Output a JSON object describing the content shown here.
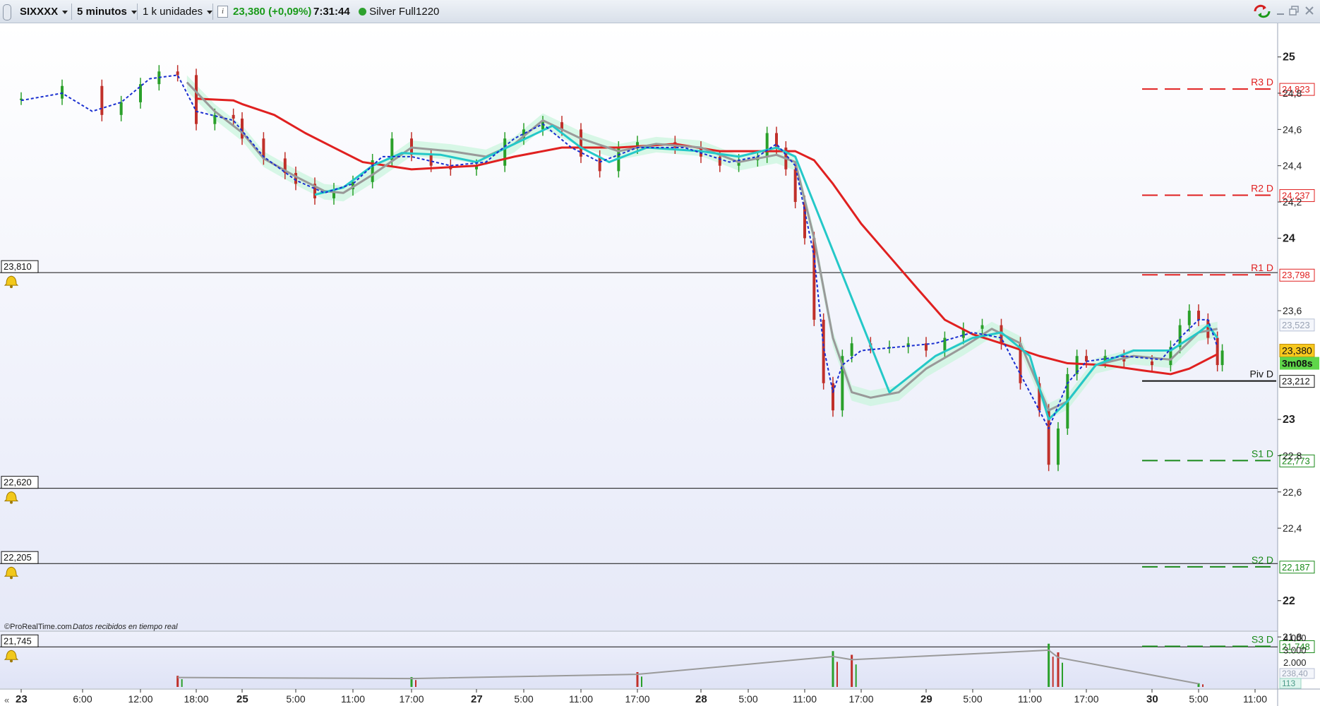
{
  "toolbar": {
    "instrument": "SIXXXX",
    "timeframe": "5 minutos",
    "units": "1 k unidades",
    "info_icon": "info-icon",
    "last_price": "23,380",
    "change_pct": "(+0,09%)",
    "time": "7:31:44",
    "feed_status_icon": "green-status-dot",
    "feed_label": "Silver Full1220",
    "window_controls": [
      "sync-icon",
      "minimize-icon",
      "restore-icon",
      "close-icon"
    ],
    "colors": {
      "price": "#1a9a1a",
      "status_dot": "#2ea12e"
    }
  },
  "chart_data": {
    "type": "line",
    "title": "",
    "subtitle": "",
    "xlabel": "",
    "ylabel": "",
    "ylim": [
      21.75,
      25.1
    ],
    "grid": false,
    "price_axis_ticks": [
      "25",
      "24,8",
      "24,6",
      "24,4",
      "24,2",
      "24",
      "23,6",
      "23",
      "22,8",
      "22,6",
      "22,4",
      "22",
      "21,8"
    ],
    "time_axis_ticks": [
      "23",
      "6:00",
      "12:00",
      "18:00",
      "25",
      "5:00",
      "11:00",
      "17:00",
      "27",
      "5:00",
      "11:00",
      "17:00",
      "28",
      "5:00",
      "11:00",
      "17:00",
      "29",
      "5:00",
      "11:00",
      "17:00",
      "30",
      "5:00",
      "11:00"
    ],
    "bold_time_ticks": [
      "23",
      "25",
      "27",
      "28",
      "29",
      "30"
    ],
    "series": [
      {
        "name": "",
        "style": "candles",
        "color_up": "#2aa02a",
        "color_down": "#c0302a",
        "points": [
          [
            "23 0:00",
            24.77
          ],
          [
            "23 4:00",
            24.84
          ],
          [
            "23 8:00",
            24.68
          ],
          [
            "23 10:00",
            24.75
          ],
          [
            "23 12:00",
            24.85
          ],
          [
            "23 14:00",
            24.92
          ],
          [
            "23 16:00",
            24.9
          ],
          [
            "23 18:00",
            24.63
          ],
          [
            "23 20:00",
            24.68
          ],
          [
            "23 22:00",
            24.66
          ],
          [
            "25 0:00",
            24.55
          ],
          [
            "25 2:00",
            24.44
          ],
          [
            "25 4:00",
            24.36
          ],
          [
            "25 5:00",
            24.3
          ],
          [
            "25 7:00",
            24.22
          ],
          [
            "25 9:00",
            24.27
          ],
          [
            "25 11:00",
            24.31
          ],
          [
            "25 13:00",
            24.43
          ],
          [
            "25 15:00",
            24.55
          ],
          [
            "25 17:00",
            24.46
          ],
          [
            "25 19:00",
            24.4
          ],
          [
            "25 21:00",
            24.38
          ],
          [
            "27 0:00",
            24.4
          ],
          [
            "27 3:00",
            24.55
          ],
          [
            "27 5:00",
            24.6
          ],
          [
            "27 7:00",
            24.64
          ],
          [
            "27 9:00",
            24.6
          ],
          [
            "27 11:00",
            24.45
          ],
          [
            "27 13:00",
            24.37
          ],
          [
            "27 15:00",
            24.5
          ],
          [
            "27 17:00",
            24.53
          ],
          [
            "27 21:00",
            24.5
          ],
          [
            "28 0:00",
            24.45
          ],
          [
            "28 2:00",
            24.4
          ],
          [
            "28 4:00",
            24.43
          ],
          [
            "28 6:00",
            24.45
          ],
          [
            "28 7:00",
            24.58
          ],
          [
            "28 8:00",
            24.5
          ],
          [
            "28 9:00",
            24.38
          ],
          [
            "28 10:00",
            24.2
          ],
          [
            "28 11:00",
            24.0
          ],
          [
            "28 12:00",
            23.55
          ],
          [
            "28 13:00",
            23.2
          ],
          [
            "28 14:00",
            23.05
          ],
          [
            "28 15:00",
            23.35
          ],
          [
            "28 16:00",
            23.42
          ],
          [
            "28 18:00",
            23.4
          ],
          [
            "28 20:00",
            23.4
          ],
          [
            "28 22:00",
            23.42
          ],
          [
            "29 0:00",
            23.38
          ],
          [
            "29 2:00",
            23.45
          ],
          [
            "29 4:00",
            23.5
          ],
          [
            "29 6:00",
            23.52
          ],
          [
            "29 8:00",
            23.42
          ],
          [
            "29 10:00",
            23.2
          ],
          [
            "29 12:00",
            23.05
          ],
          [
            "29 13:00",
            22.75
          ],
          [
            "29 14:00",
            22.95
          ],
          [
            "29 15:00",
            23.25
          ],
          [
            "29 16:00",
            23.35
          ],
          [
            "29 17:00",
            23.32
          ],
          [
            "29 19:00",
            23.35
          ],
          [
            "29 21:00",
            23.32
          ],
          [
            "30 0:00",
            23.3
          ],
          [
            "30 2:00",
            23.4
          ],
          [
            "30 3:00",
            23.52
          ],
          [
            "30 4:00",
            23.6
          ],
          [
            "30 5:00",
            23.55
          ],
          [
            "30 6:00",
            23.45
          ],
          [
            "30 7:00",
            23.3
          ],
          [
            "30 7:31",
            23.38
          ]
        ]
      },
      {
        "name": "",
        "style": "line",
        "color": "#e02020",
        "points": [
          [
            "23 18:00",
            24.77
          ],
          [
            "23 22:00",
            24.76
          ],
          [
            "25 0:00",
            24.74
          ],
          [
            "25 3:00",
            24.68
          ],
          [
            "25 6:00",
            24.58
          ],
          [
            "25 9:00",
            24.5
          ],
          [
            "25 12:00",
            24.42
          ],
          [
            "25 17:00",
            24.38
          ],
          [
            "27 0:00",
            24.4
          ],
          [
            "27 4:00",
            24.45
          ],
          [
            "27 9:00",
            24.5
          ],
          [
            "27 15:00",
            24.5
          ],
          [
            "27 21:00",
            24.52
          ],
          [
            "28 2:00",
            24.48
          ],
          [
            "28 6:00",
            24.48
          ],
          [
            "28 10:00",
            24.48
          ],
          [
            "28 12:00",
            24.43
          ],
          [
            "28 14:00",
            24.3
          ],
          [
            "28 17:00",
            24.08
          ],
          [
            "28 20:00",
            23.9
          ],
          [
            "28 23:00",
            23.72
          ],
          [
            "29 2:00",
            23.55
          ],
          [
            "29 5:00",
            23.47
          ],
          [
            "29 8:00",
            23.42
          ],
          [
            "29 12:00",
            23.35
          ],
          [
            "29 15:00",
            23.31
          ],
          [
            "29 19:00",
            23.3
          ],
          [
            "29 23:00",
            23.27
          ],
          [
            "30 2:00",
            23.25
          ],
          [
            "30 4:00",
            23.28
          ],
          [
            "30 7:00",
            23.36
          ]
        ]
      },
      {
        "name": "",
        "style": "line",
        "color": "#999999",
        "points": [
          [
            "23 17:00",
            24.86
          ],
          [
            "23 20:00",
            24.7
          ],
          [
            "23 23:00",
            24.58
          ],
          [
            "25 2:00",
            24.44
          ],
          [
            "25 5:00",
            24.34
          ],
          [
            "25 8:00",
            24.26
          ],
          [
            "25 10:00",
            24.25
          ],
          [
            "25 13:00",
            24.35
          ],
          [
            "25 17:00",
            24.5
          ],
          [
            "25 21:00",
            24.48
          ],
          [
            "27 1:00",
            24.45
          ],
          [
            "27 4:00",
            24.52
          ],
          [
            "27 7:00",
            24.65
          ],
          [
            "27 11:00",
            24.55
          ],
          [
            "27 15:00",
            24.48
          ],
          [
            "27 19:00",
            24.52
          ],
          [
            "28 0:00",
            24.5
          ],
          [
            "28 4:00",
            24.42
          ],
          [
            "28 8:00",
            24.46
          ],
          [
            "28 10:00",
            24.42
          ],
          [
            "28 12:00",
            24.0
          ],
          [
            "28 14:00",
            23.45
          ],
          [
            "28 16:00",
            23.15
          ],
          [
            "28 18:00",
            23.12
          ],
          [
            "28 21:00",
            23.15
          ],
          [
            "29 0:00",
            23.28
          ],
          [
            "29 4:00",
            23.4
          ],
          [
            "29 7:00",
            23.5
          ],
          [
            "29 10:00",
            23.42
          ],
          [
            "29 13:00",
            23.05
          ],
          [
            "29 15:00",
            23.1
          ],
          [
            "29 18:00",
            23.3
          ],
          [
            "29 22:00",
            23.35
          ],
          [
            "30 2:00",
            23.33
          ],
          [
            "30 5:00",
            23.48
          ],
          [
            "30 7:00",
            23.5
          ]
        ]
      },
      {
        "name": "",
        "style": "line",
        "color": "#24c8c8",
        "points": [
          [
            "25 7:00",
            24.24
          ],
          [
            "25 10:00",
            24.28
          ],
          [
            "25 13:00",
            24.4
          ],
          [
            "25 16:00",
            24.47
          ],
          [
            "25 20:00",
            24.46
          ],
          [
            "27 0:00",
            24.42
          ],
          [
            "27 4:00",
            24.52
          ],
          [
            "27 8:00",
            24.62
          ],
          [
            "27 11:00",
            24.5
          ],
          [
            "27 14:00",
            24.42
          ],
          [
            "27 18:00",
            24.5
          ],
          [
            "28 0:00",
            24.48
          ],
          [
            "28 4:00",
            24.45
          ],
          [
            "28 8:00",
            24.5
          ],
          [
            "28 10:00",
            24.45
          ],
          [
            "28 20:00",
            23.15
          ],
          [
            "29 1:00",
            23.35
          ],
          [
            "29 5:00",
            23.45
          ],
          [
            "29 8:00",
            23.48
          ],
          [
            "29 11:00",
            23.35
          ],
          [
            "29 13:00",
            23.0
          ],
          [
            "29 15:00",
            23.1
          ],
          [
            "29 18:00",
            23.3
          ],
          [
            "29 22:00",
            23.38
          ],
          [
            "30 2:00",
            23.38
          ],
          [
            "30 5:00",
            23.48
          ],
          [
            "30 6:00",
            23.52
          ],
          [
            "30 7:00",
            23.45
          ]
        ]
      },
      {
        "name": "",
        "style": "line",
        "dash": true,
        "color": "#1a2fd0",
        "points": [
          [
            "23 0:00",
            24.76
          ],
          [
            "23 4:00",
            24.8
          ],
          [
            "23 7:00",
            24.7
          ],
          [
            "23 10:00",
            24.75
          ],
          [
            "23 13:00",
            24.88
          ],
          [
            "23 16:00",
            24.9
          ],
          [
            "23 18:00",
            24.7
          ],
          [
            "23 22:00",
            24.65
          ],
          [
            "25 2:00",
            24.45
          ],
          [
            "25 5:00",
            24.32
          ],
          [
            "25 8:00",
            24.25
          ],
          [
            "25 11:00",
            24.3
          ],
          [
            "25 14:00",
            24.45
          ],
          [
            "25 17:00",
            24.45
          ],
          [
            "25 21:00",
            24.4
          ],
          [
            "27 1:00",
            24.42
          ],
          [
            "27 4:00",
            24.55
          ],
          [
            "27 7:00",
            24.63
          ],
          [
            "27 10:00",
            24.5
          ],
          [
            "27 13:00",
            24.42
          ],
          [
            "27 17:00",
            24.5
          ],
          [
            "27 22:00",
            24.5
          ],
          [
            "28 3:00",
            24.42
          ],
          [
            "28 6:00",
            24.45
          ],
          [
            "28 8:00",
            24.52
          ],
          [
            "28 10:00",
            24.4
          ],
          [
            "28 12:00",
            23.9
          ],
          [
            "28 13:00",
            23.4
          ],
          [
            "28 14:00",
            23.15
          ],
          [
            "28 15:00",
            23.3
          ],
          [
            "28 17:00",
            23.38
          ],
          [
            "28 21:00",
            23.4
          ],
          [
            "29 1:00",
            23.42
          ],
          [
            "29 5:00",
            23.48
          ],
          [
            "29 8:00",
            23.45
          ],
          [
            "29 10:00",
            23.25
          ],
          [
            "29 12:00",
            23.05
          ],
          [
            "29 13:00",
            22.95
          ],
          [
            "29 15:00",
            23.2
          ],
          [
            "29 17:00",
            23.32
          ],
          [
            "29 21:00",
            23.35
          ],
          [
            "30 1:00",
            23.33
          ],
          [
            "30 3:00",
            23.45
          ],
          [
            "30 5:00",
            23.55
          ],
          [
            "30 6:00",
            23.55
          ],
          [
            "30 7:00",
            23.4
          ]
        ]
      }
    ],
    "pivot_levels": [
      {
        "label": "R3 D",
        "value": "24,823",
        "color": "#e02020",
        "dashed": true
      },
      {
        "label": "R2 D",
        "value": "24,237",
        "color": "#e02020",
        "dashed": true
      },
      {
        "label": "R1 D",
        "value": "23,798",
        "color": "#e02020",
        "dashed": true
      },
      {
        "label": "Piv D",
        "value": "23,212",
        "color": "#111111",
        "dashed": false
      },
      {
        "label": "S1 D",
        "value": "22,773",
        "color": "#1a8a1a",
        "dashed": true
      },
      {
        "label": "S2 D",
        "value": "22,187",
        "color": "#1a8a1a",
        "dashed": true
      },
      {
        "label": "S3 D",
        "value": "21,748",
        "color": "#1a8a1a",
        "dashed": true
      }
    ],
    "alert_lines": [
      {
        "value": "23,810",
        "icon": "bell-icon"
      },
      {
        "value": "22,620",
        "icon": "bell-icon"
      },
      {
        "value": "22,205",
        "icon": "bell-icon"
      },
      {
        "value": "21,745",
        "icon": "bell-icon"
      }
    ],
    "axis_badges": [
      {
        "text": "23,523",
        "kind": "ma"
      },
      {
        "text": "23,380",
        "kind": "last-price"
      },
      {
        "text": "3m08s",
        "kind": "countdown"
      }
    ],
    "volume_panel": {
      "ticks": [
        "4.000",
        "3.000",
        "2.000"
      ],
      "badges": [
        "238,40",
        "113"
      ],
      "peaks": [
        [
          "23 16:00",
          900
        ],
        [
          "25 17:00",
          800
        ],
        [
          "27 17:00",
          1200
        ],
        [
          "28 14:00",
          2900
        ],
        [
          "28 16:00",
          2600
        ],
        [
          "29 13:00",
          3500
        ],
        [
          "29 14:00",
          2800
        ],
        [
          "30 5:00",
          300
        ]
      ]
    },
    "footer": {
      "source": "©ProRealTime.com",
      "note": "Datos recibidos en tiempo real"
    }
  }
}
